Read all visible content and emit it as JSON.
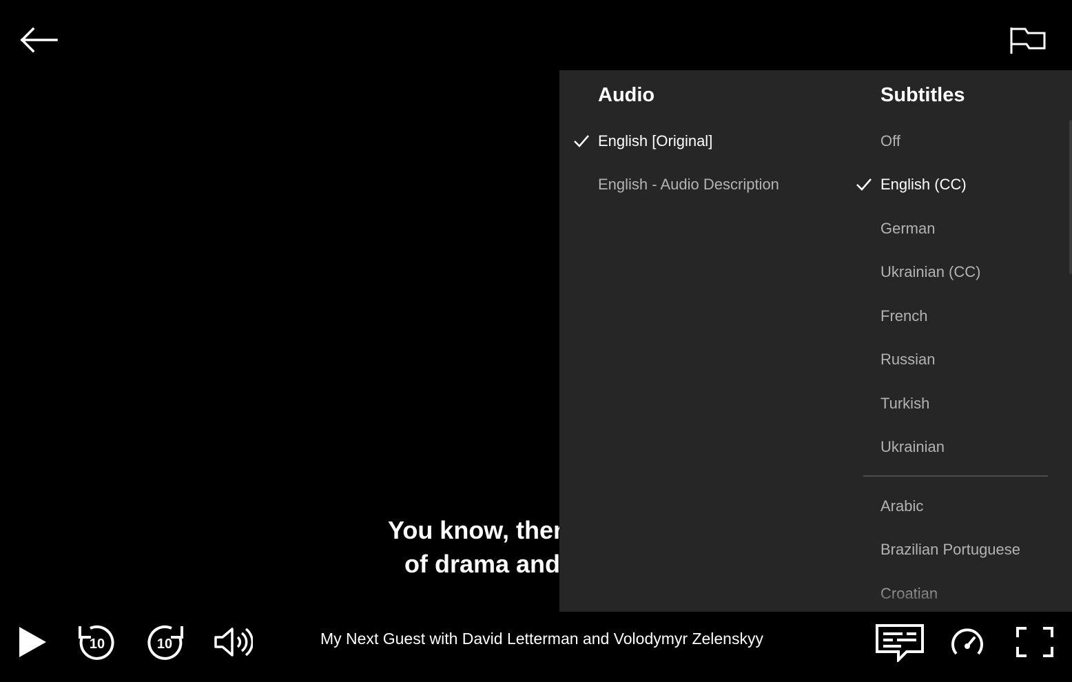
{
  "player": {
    "subtitle_lines": "You know, there\nof drama and",
    "episode_title": "My Next Guest with David Letterman and Volodymyr Zelenskyy"
  },
  "top_bar": {
    "back_icon": "arrow-left-icon",
    "report_icon": "flag-icon"
  },
  "panel": {
    "audio": {
      "title": "Audio",
      "options": [
        {
          "label": "English [Original]",
          "selected": true
        },
        {
          "label": "English - Audio Description",
          "selected": false
        }
      ]
    },
    "subtitles": {
      "title": "Subtitles",
      "options": [
        {
          "label": "Off",
          "selected": false
        },
        {
          "label": "English (CC)",
          "selected": true
        },
        {
          "label": "German",
          "selected": false
        },
        {
          "label": "Ukrainian (CC)",
          "selected": false
        },
        {
          "label": "French",
          "selected": false
        },
        {
          "label": "Russian",
          "selected": false
        },
        {
          "label": "Turkish",
          "selected": false
        },
        {
          "label": "Ukrainian",
          "selected": false
        }
      ],
      "more_options": [
        {
          "label": "Arabic",
          "selected": false
        },
        {
          "label": "Brazilian Portuguese",
          "selected": false
        },
        {
          "label": "Croatian",
          "selected": false
        }
      ]
    }
  },
  "controls": {
    "play_icon": "play-icon",
    "rewind_icon": "rewind-10-icon",
    "forward_icon": "forward-10-icon",
    "volume_icon": "volume-icon",
    "subtitles_icon": "subtitles-icon",
    "speed_icon": "playback-speed-icon",
    "fullscreen_icon": "fullscreen-icon",
    "skip_seconds": "10"
  },
  "colors": {
    "background": "#000000",
    "panel": "#262626",
    "text_active": "#ffffff",
    "text_inactive": "#b3b3b3",
    "divider": "#4d4d4d"
  }
}
